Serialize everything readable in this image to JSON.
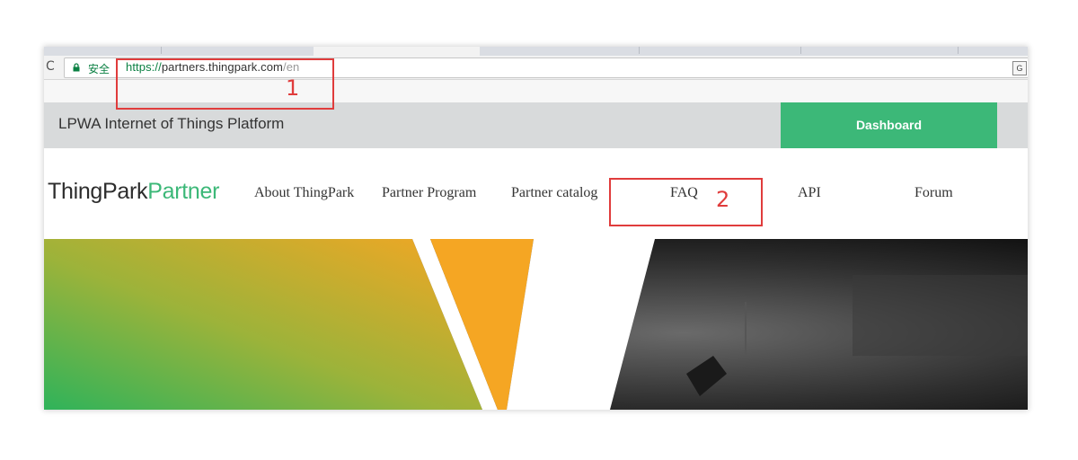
{
  "browser": {
    "secure_label": "安全",
    "url_scheme": "https://",
    "url_host": "partners.thingpark.com",
    "url_path": "/en",
    "translate_label": "G",
    "reload_symbol": "C"
  },
  "header": {
    "title": "LPWA Internet of Things Platform",
    "dashboard_label": "Dashboard"
  },
  "logo": {
    "part1": "ThingPark",
    "part2": "Partner"
  },
  "nav": {
    "items": [
      {
        "label": "About ThingPark"
      },
      {
        "label": "Partner Program"
      },
      {
        "label": "Partner catalog"
      },
      {
        "label": "FAQ"
      },
      {
        "label": "API"
      },
      {
        "label": "Forum"
      }
    ]
  },
  "annotations": [
    {
      "label": "1"
    },
    {
      "label": "2"
    }
  ],
  "colors": {
    "accent_green": "#3cb878",
    "hero_orange": "#f5a623",
    "annotation_red": "#e03c3c"
  }
}
